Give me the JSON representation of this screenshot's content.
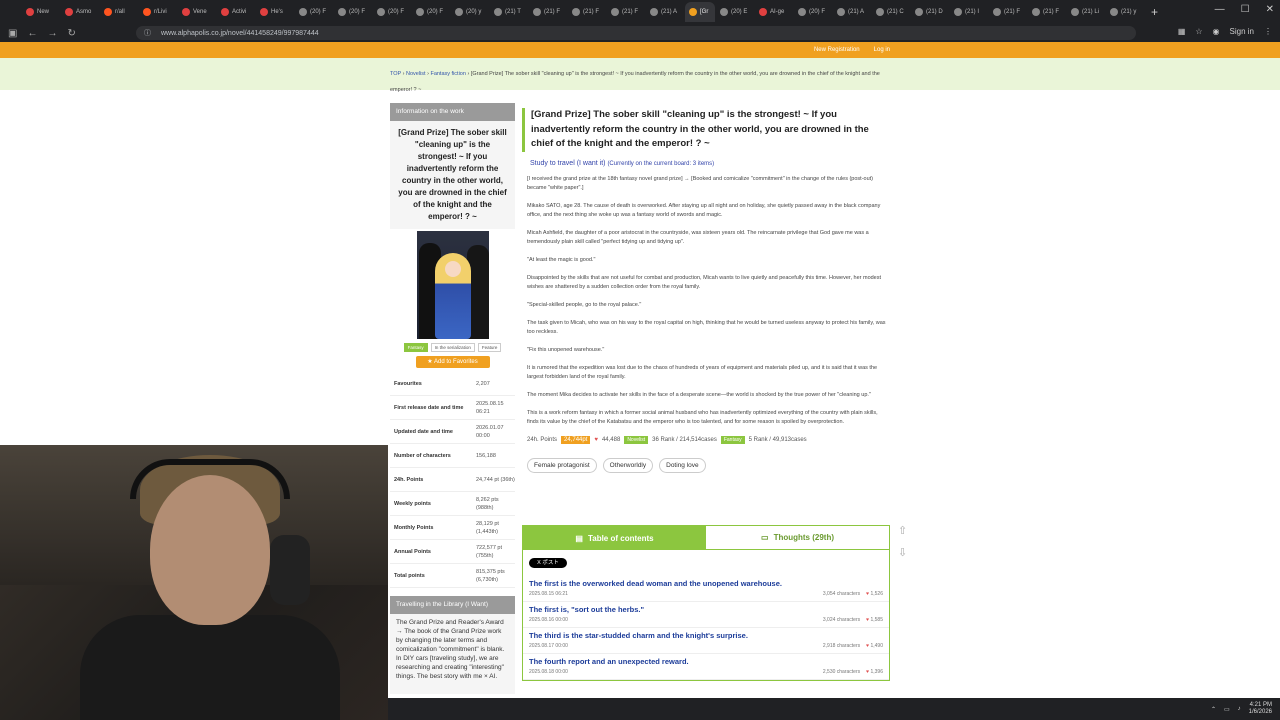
{
  "browser": {
    "tabs": [
      {
        "label": "New",
        "color": "#e04040"
      },
      {
        "label": "Asmo",
        "color": "#e04040"
      },
      {
        "label": "r/all",
        "color": "#ff5520"
      },
      {
        "label": "r/Livi",
        "color": "#ff5520"
      },
      {
        "label": "Vene",
        "color": "#e04040"
      },
      {
        "label": "Activi",
        "color": "#e04040"
      },
      {
        "label": "He's",
        "color": "#e04040"
      },
      {
        "label": "(20) F",
        "color": "#888"
      },
      {
        "label": "(20) F",
        "color": "#888"
      },
      {
        "label": "(20) F",
        "color": "#888"
      },
      {
        "label": "(20) F",
        "color": "#888"
      },
      {
        "label": "(20) y",
        "color": "#888"
      },
      {
        "label": "(21) T",
        "color": "#888"
      },
      {
        "label": "(21) F",
        "color": "#888"
      },
      {
        "label": "(21) F",
        "color": "#888"
      },
      {
        "label": "(21) F",
        "color": "#888"
      },
      {
        "label": "(21) A",
        "color": "#888"
      },
      {
        "label": "[Gr",
        "color": "#f0a020",
        "active": true
      },
      {
        "label": "(20) E",
        "color": "#888"
      },
      {
        "label": "AI-ge",
        "color": "#e04040"
      },
      {
        "label": "(20) F",
        "color": "#888"
      },
      {
        "label": "(21) A",
        "color": "#888"
      },
      {
        "label": "(21) C",
        "color": "#888"
      },
      {
        "label": "(21) D",
        "color": "#888"
      },
      {
        "label": "(21) I",
        "color": "#888"
      },
      {
        "label": "(21) F",
        "color": "#888"
      },
      {
        "label": "(21) F",
        "color": "#888"
      },
      {
        "label": "(21) Li",
        "color": "#888"
      },
      {
        "label": "(21) y",
        "color": "#888"
      }
    ],
    "url": "www.alphapolis.co.jp/novel/441458249/997987444",
    "sign_in": "Sign in"
  },
  "site": {
    "new_registration": "New Registration",
    "login": "Log in"
  },
  "breadcrumb": {
    "top": "TOP",
    "novelist": "Novelist",
    "fantasy": "Fantasy fiction",
    "current": "[Grand Prize] The sober skill \"cleaning up\" is the strongest! ~ If you inadvertently reform the country in the other world, you are drowned in the chief of the knight and the emperor! ? ~"
  },
  "sidebar": {
    "info_header": "Information on the work",
    "title": "[Grand Prize] The sober skill \"cleaning up\" is the strongest! ~ If you inadvertently reform the country in the other world, you are drowned in the chief of the knight and the emperor! ? ~",
    "tags": [
      "Fantasy",
      "In the serialization",
      "Feature"
    ],
    "add_favorites": "★ Add to Favorites",
    "stats": [
      {
        "label": "Favourites",
        "value": "2,207"
      },
      {
        "label": "First release date and time",
        "value": "2025.08.15 06:21"
      },
      {
        "label": "Updated date and time",
        "value": "2026.01.07 00:00"
      },
      {
        "label": "Number of characters",
        "value": "156,188"
      },
      {
        "label": "24h. Points",
        "value": "24,744 pt (36th)"
      },
      {
        "label": "Weekly points",
        "value": "8,262 pts (988th)"
      },
      {
        "label": "Monthly Points",
        "value": "28,129 pt (1,443th)"
      },
      {
        "label": "Annual Points",
        "value": "722,577 pt (755th)"
      },
      {
        "label": "Total points",
        "value": "815,375 pts (6,730th)"
      }
    ],
    "lib_header": "Travelling in the Library (I Want)",
    "lib_text": "The Grand Prize and Reader's Award → The book of the Grand Prize work by changing the later terms and comicalization \"commitment\" is blank. In DIY cars [traveling study], we are researching and creating \"interesting\" things. The best story with me × AI."
  },
  "main": {
    "title": "[Grand Prize] The sober skill \"cleaning up\" is the strongest! ~ If you inadvertently reform the country in the other world, you are drowned in the chief of the knight and the emperor! ? ~",
    "travel_link": "Study to travel (I want it)",
    "travel_note": "(Currently on the current board: 3 items)",
    "synopsis": [
      "[I received the grand prize at the 18th fantasy novel grand prize] → [Booked and comicalize \"commitment\" in the change of the rules (post-out) became \"white paper\".]",
      "Mikako SATO, age 28. The cause of death is overworked. After staying up all night and on holiday, she quietly passed away in the black company office, and the next thing she woke up was a fantasy world of swords and magic.",
      "Micah Ashfield, the daughter of a poor aristocrat in the countryside, was sixteen years old. The reincarnate privilege that God gave me was a tremendously plain skill called \"perfect tidying up and tidying up\".",
      "\"At least the magic is good.\"",
      "Disappointed by the skills that are not useful for combat and production, Micah wants to live quietly and peacefully this time. However, her modest wishes are shattered by a sudden collection order from the royal family.",
      "\"Special-skilled people, go to the royal palace.\"",
      "The task given to Micah, who was on his way to the royal capital on high, thinking that he would be turned useless anyway to protect his family, was too reckless.",
      "\"Fix this unopened warehouse.\"",
      "It is rumored that the expedition was lost due to the chaos of hundreds of years of equipment and materials piled up, and it is said that it was the largest forbidden land of the royal family.",
      "The moment Mika decides to activate her skills in the face of a desperate scene—the world is shocked by the true power of her \"cleaning up.\"",
      "This is a work reform fantasy in which a former social animal husband who has inadvertently optimized everything of the country with plain skills, finds its value by the chief of the Katabatsu and the emperor who is too talented, and for some reason is spoiled by overprotection."
    ],
    "ranks": {
      "label_24h": "24h. Points",
      "points": "24,744pt",
      "hearts": "44,488",
      "novelist_tag": "Novelist",
      "novelist_rank": "36 Rank / 214,514cases",
      "fantasy_tag": "Fantasy",
      "fantasy_rank": "5 Rank / 49,913cases"
    },
    "keywords": [
      "Female protagonist",
      "Otherworldly",
      "Doting love"
    ],
    "toc": {
      "tab_toc": "Table of contents",
      "tab_thoughts": "Thoughts (29th)",
      "xpost": "X ポスト",
      "episodes": [
        {
          "title": "The first is the overworked dead woman and the unopened warehouse.",
          "date": "2025.08.15 06:21",
          "chars": "3,054 characters",
          "likes": "1,526"
        },
        {
          "title": "The first is, \"sort out the herbs.\"",
          "date": "2025.08.16 00:00",
          "chars": "3,024 characters",
          "likes": "1,585"
        },
        {
          "title": "The third is the star-studded charm and the knight's surprise.",
          "date": "2025.08.17 00:00",
          "chars": "2,918 characters",
          "likes": "1,490"
        },
        {
          "title": "The fourth report and an unexpected reward.",
          "date": "2025.08.18 00:00",
          "chars": "2,530 characters",
          "likes": "1,396"
        }
      ]
    }
  },
  "taskbar": {
    "time": "4:21 PM",
    "date": "1/6/2026"
  }
}
